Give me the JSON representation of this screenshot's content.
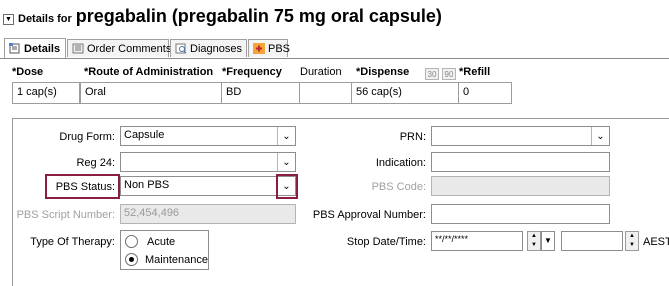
{
  "header": {
    "collapse_glyph": "▼",
    "prefix": "Details for",
    "title": "pregabalin (pregabalin 75 mg oral capsule)"
  },
  "tabs": [
    {
      "label": "Details",
      "icon": "details-icon",
      "active": true
    },
    {
      "label": "Order Comments",
      "icon": "comments-icon",
      "active": false
    },
    {
      "label": "Diagnoses",
      "icon": "diagnoses-icon",
      "active": false
    },
    {
      "label": "PBS",
      "icon": "pbs-icon",
      "active": false
    }
  ],
  "order_row": {
    "headers": {
      "dose": "*Dose",
      "route": "*Route of Administration",
      "frequency": "*Frequency",
      "duration": "Duration",
      "dispense": "*Dispense",
      "btn30": "30",
      "btn90": "90",
      "refill": "*Refill"
    },
    "values": {
      "dose": "1 cap(s)",
      "route": "Oral",
      "frequency": "BD",
      "duration": "",
      "dispense": "56 cap(s)",
      "refill": "0"
    }
  },
  "form": {
    "drug_form_label": "Drug Form:",
    "drug_form_value": "Capsule",
    "reg24_label": "Reg 24:",
    "reg24_value": "",
    "pbs_status_label": "PBS Status:",
    "pbs_status_value": "Non PBS",
    "pbs_script_label": "PBS Script Number:",
    "pbs_script_value": "52,454,496",
    "therapy_label": "Type Of Therapy:",
    "therapy_options": [
      "Acute",
      "Maintenance"
    ],
    "therapy_selected": "Maintenance",
    "prn_label": "PRN:",
    "prn_value": "",
    "indication_label": "Indication:",
    "indication_value": "",
    "pbs_code_label": "PBS Code:",
    "pbs_code_value": "",
    "pbs_approval_label": "PBS Approval Number:",
    "pbs_approval_value": "",
    "stop_label": "Stop Date/Time:",
    "stop_date_placeholder": "**/**/****",
    "stop_time_value": "",
    "timezone": "AEST"
  },
  "colors": {
    "highlight": "#8b1e3f",
    "disabled_bg": "#e9e9e9",
    "border": "#9c9c9c"
  }
}
